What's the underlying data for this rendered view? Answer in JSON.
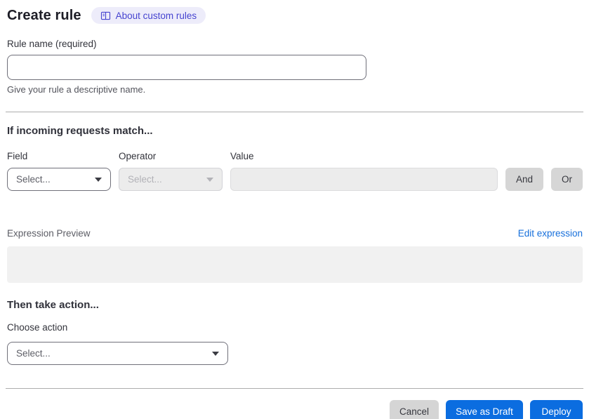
{
  "header": {
    "title": "Create rule",
    "about_badge_label": "About custom rules"
  },
  "rule_name": {
    "label": "Rule name (required)",
    "value": "",
    "helper": "Give your rule a descriptive name."
  },
  "match_section": {
    "heading": "If incoming requests match...",
    "field_label": "Field",
    "field_value": "Select...",
    "operator_label": "Operator",
    "operator_value": "Select...",
    "value_label": "Value",
    "value_value": "",
    "and_label": "And",
    "or_label": "Or"
  },
  "expression": {
    "label": "Expression Preview",
    "edit_link": "Edit expression",
    "preview_value": ""
  },
  "action_section": {
    "heading": "Then take action...",
    "choose_label": "Choose action",
    "select_value": "Select..."
  },
  "footer": {
    "cancel_label": "Cancel",
    "save_draft_label": "Save as Draft",
    "deploy_label": "Deploy"
  },
  "colors": {
    "primary_blue": "#0b6de0",
    "link_blue": "#166fdb",
    "badge_bg": "#edecfa",
    "badge_text": "#4644d0",
    "disabled_bg": "#ececec",
    "gray_button": "#d6d6d6"
  }
}
